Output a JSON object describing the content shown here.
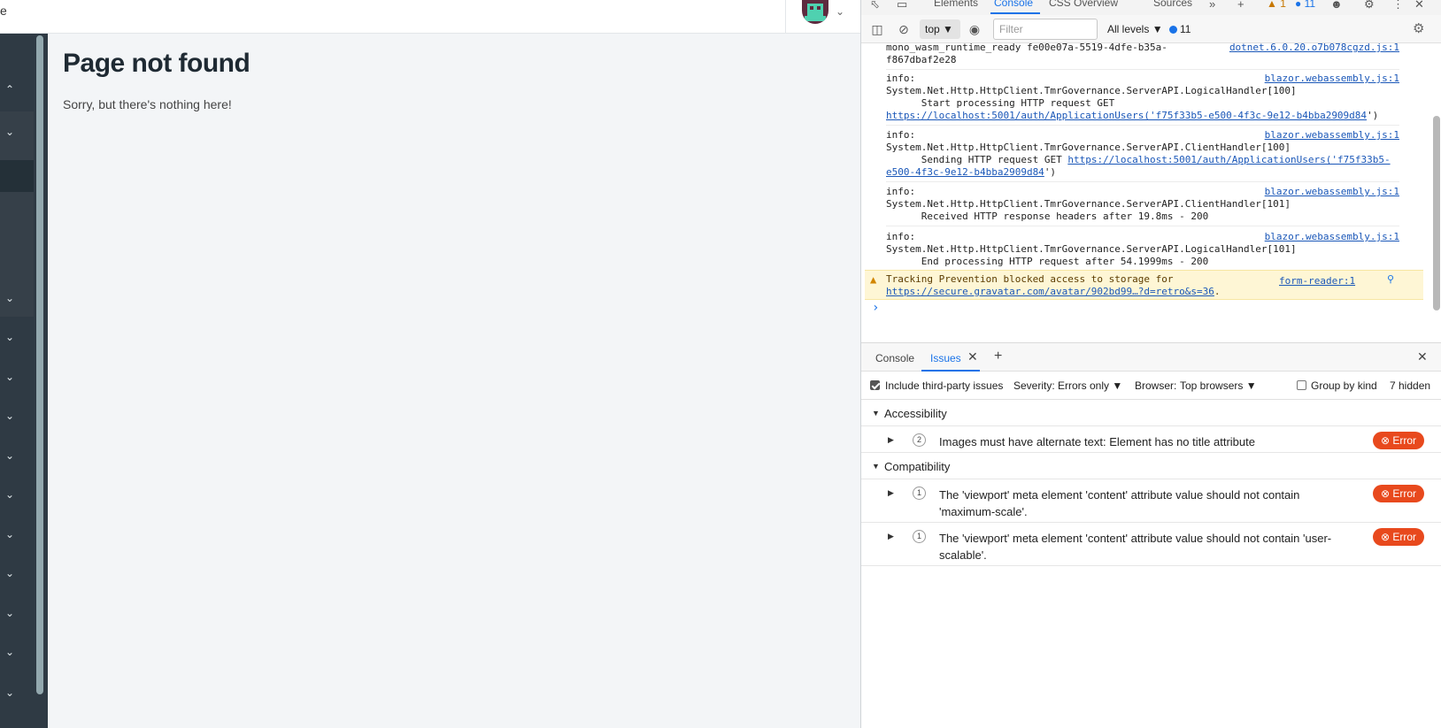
{
  "app": {
    "top_cut_text": "e",
    "page_title": "Page not found",
    "page_message": "Sorry, but there's nothing here!",
    "sidebar_chevrons": [
      "up",
      "down",
      "down",
      "down",
      "down",
      "down",
      "down",
      "down",
      "down",
      "down",
      "down",
      "down"
    ]
  },
  "devtools": {
    "tabs": [
      "Elements",
      "Console",
      "CSS Overview",
      "Sources"
    ],
    "active_tab": "Console",
    "warn_count": "1",
    "info_count": "11",
    "context": "top",
    "filter_placeholder": "Filter",
    "levels": "All levels",
    "message_count": "11",
    "console_entries": [
      {
        "src": "dotnet.6.0.20.o7b078cgzd.js:1",
        "lines": "mono_wasm_runtime_ready fe00e07a-5519-4dfe-b35a-\nf867dbaf2e28"
      },
      {
        "src": "blazor.webassembly.js:1",
        "lines": "info:\nSystem.Net.Http.HttpClient.TmrGovernance.ServerAPI.LogicalHandler[100]\n      Start processing HTTP request GET ",
        "link": "https://localhost:5001/auth/ApplicationUsers('f75f33b5-e500-4f3c-9e12-b4bba2909d84",
        "tail": "')"
      },
      {
        "src": "blazor.webassembly.js:1",
        "lines": "info:\nSystem.Net.Http.HttpClient.TmrGovernance.ServerAPI.ClientHandler[100]\n      Sending HTTP request GET ",
        "link": "https://localhost:5001/auth/ApplicationUsers('f75f33b5-e500-4f3c-9e12-b4bba2909d84",
        "tail": "')"
      },
      {
        "src": "blazor.webassembly.js:1",
        "lines": "info:\nSystem.Net.Http.HttpClient.TmrGovernance.ServerAPI.ClientHandler[101]\n      Received HTTP response headers after 19.8ms - 200"
      },
      {
        "src": "blazor.webassembly.js:1",
        "lines": "info:\nSystem.Net.Http.HttpClient.TmrGovernance.ServerAPI.LogicalHandler[101]\n      End processing HTTP request after 54.1999ms - 200"
      }
    ],
    "warning": {
      "text": "Tracking Prevention blocked access to storage for ",
      "link": "https://secure.gravatar.com/avatar/902bd99…?d=retro&s=36",
      "tail": ".",
      "src": "form-reader:1"
    },
    "drawer_tabs": [
      "Console",
      "Issues"
    ],
    "issues_toolbar": {
      "include_third_party": "Include third-party issues",
      "severity_label": "Severity:",
      "severity_value": "Errors only",
      "browser_label": "Browser:",
      "browser_value": "Top browsers",
      "group_by_kind": "Group by kind",
      "hidden": "7 hidden"
    },
    "issue_groups": [
      {
        "name": "Accessibility",
        "issues": [
          {
            "count": "2",
            "text": "Images must have alternate text: Element has no title attribute",
            "severity": "Error"
          }
        ]
      },
      {
        "name": "Compatibility",
        "issues": [
          {
            "count": "1",
            "text": "The 'viewport' meta element 'content' attribute value should not contain 'maximum-scale'.",
            "severity": "Error"
          },
          {
            "count": "1",
            "text": "The 'viewport' meta element 'content' attribute value should not contain 'user-scalable'.",
            "severity": "Error"
          }
        ]
      }
    ]
  }
}
